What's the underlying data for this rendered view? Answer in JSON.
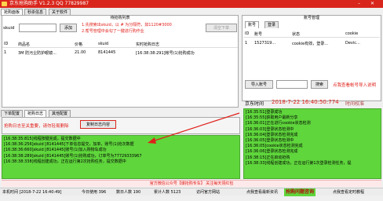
{
  "title_bar": {
    "title": "京东抢购助手 V1.2.3  QQ 77829987"
  },
  "top_tabs": [
    "抢购面板",
    "秒杀信息",
    "关于软件"
  ],
  "product_panel": {
    "header": "待抢购列表",
    "skuid_label": "skuid",
    "add_button": "添加",
    "hint_line1": "1.先搜索出skuid，以 # 为分隔符，如1120#3000",
    "hint_line2": "2.帮号管理中会勾了一键进行购作业",
    "clear_button": "清空下单",
    "columns": [
      "ID",
      "商品名",
      "价格",
      "skuid",
      "实时抢购日志"
    ],
    "rows": [
      [
        "1",
        "3M 防污尘防护眼镜...",
        "21.00",
        "8141445",
        "[16:38:38:291]帐号(1)抢购成功"
      ]
    ]
  },
  "account_panel": {
    "header": "账号管理",
    "tabs": [
      "账号",
      "登录"
    ],
    "columns": [
      "ID",
      "账号",
      "状态",
      "cookie"
    ],
    "rows": [
      [
        "1",
        "1527319...",
        "cookie有效，登录...",
        "Devic..."
      ]
    ],
    "import_button": "导入账号",
    "search_button": "搜索",
    "status_hint": "点我查看帐号导入说明"
  },
  "time_row": {
    "label": "京东时间",
    "time": "2018-7-22 16:40:50:774",
    "sync_label": "时间校准"
  },
  "bottom_tabs": [
    "下单配置",
    "抢购日志",
    "其他配置"
  ],
  "log_toolbar": {
    "hint": "抢购日志至关重要，请勿轻易删除",
    "copy_button": "复制日志内容"
  },
  "left_log": [
    "[16:38:35:815]线程按键完成，提交数据中",
    "[16:38:36:256]skuid [8141445]下单信息提交，加单，账号(1)抢次数据",
    "[16:38:36:660]skuid [8141445]账号(1)加入购物车成功",
    "[16:38:38:289]skuid [8141445]账号(1)抢购成功，订单号为77729333967",
    "[16:38:38:338]线程创建成功，正在运行第2次抢购任务，提交数据中"
  ],
  "right_log": [
    "[16:35:51]登录成功",
    "[16:35:55]获取用户最新分享",
    "[16:36:01]正在进行cookie状态检测",
    "[16:36:03]登录状态检测中",
    "[16:36:04]登录状态检测完成",
    "[16:36:05]登录状态检测中",
    "[16:36:05]cookie状态检测完成",
    "[16:36:06]登录状态检测完成",
    "[16:38:15]正在启动抢购",
    "[16:38:33]线程创建成功，正在运行第1次登录检测任务，提"
  ],
  "promo_banner": {
    "text": "官方微信公众号【爆抢购专车】  关注每天领红包"
  },
  "status_bar": {
    "local_time": "本机时间 [2018-7-22 16:40:49]",
    "today_usage": "今日使用 396",
    "visitors": "数日人数 190",
    "total": "累计人数 5123",
    "visit_site": "访问官方网站",
    "right_link1": "点我查看最新资讯",
    "right_link2": "抢购问题咨询",
    "right_link3": "点我查看定时教程"
  },
  "colors": {
    "accent_red": "#d9261c",
    "log_green": "#5fd63c"
  }
}
